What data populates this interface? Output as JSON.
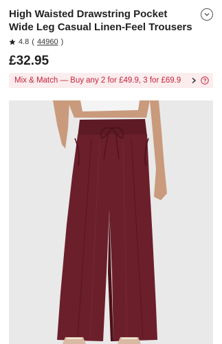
{
  "product": {
    "title": "High Waisted Drawstring Pocket Wide Leg Casual Linen-Feel Trousers",
    "rating": "4.8",
    "review_count": "44960",
    "price": "£32.95"
  },
  "promo": {
    "text": "Mix & Match — Buy any 2 for £49.9, 3 for £69.9"
  },
  "icons": {
    "collapse": "chevron-down-circle-icon",
    "star": "star-icon",
    "promo_arrow": "chevron-right-icon",
    "help": "question-circle-icon"
  },
  "colors": {
    "accent": "#c4243d",
    "promo_bg": "#fbeced",
    "trousers": "#6b1f2b"
  }
}
